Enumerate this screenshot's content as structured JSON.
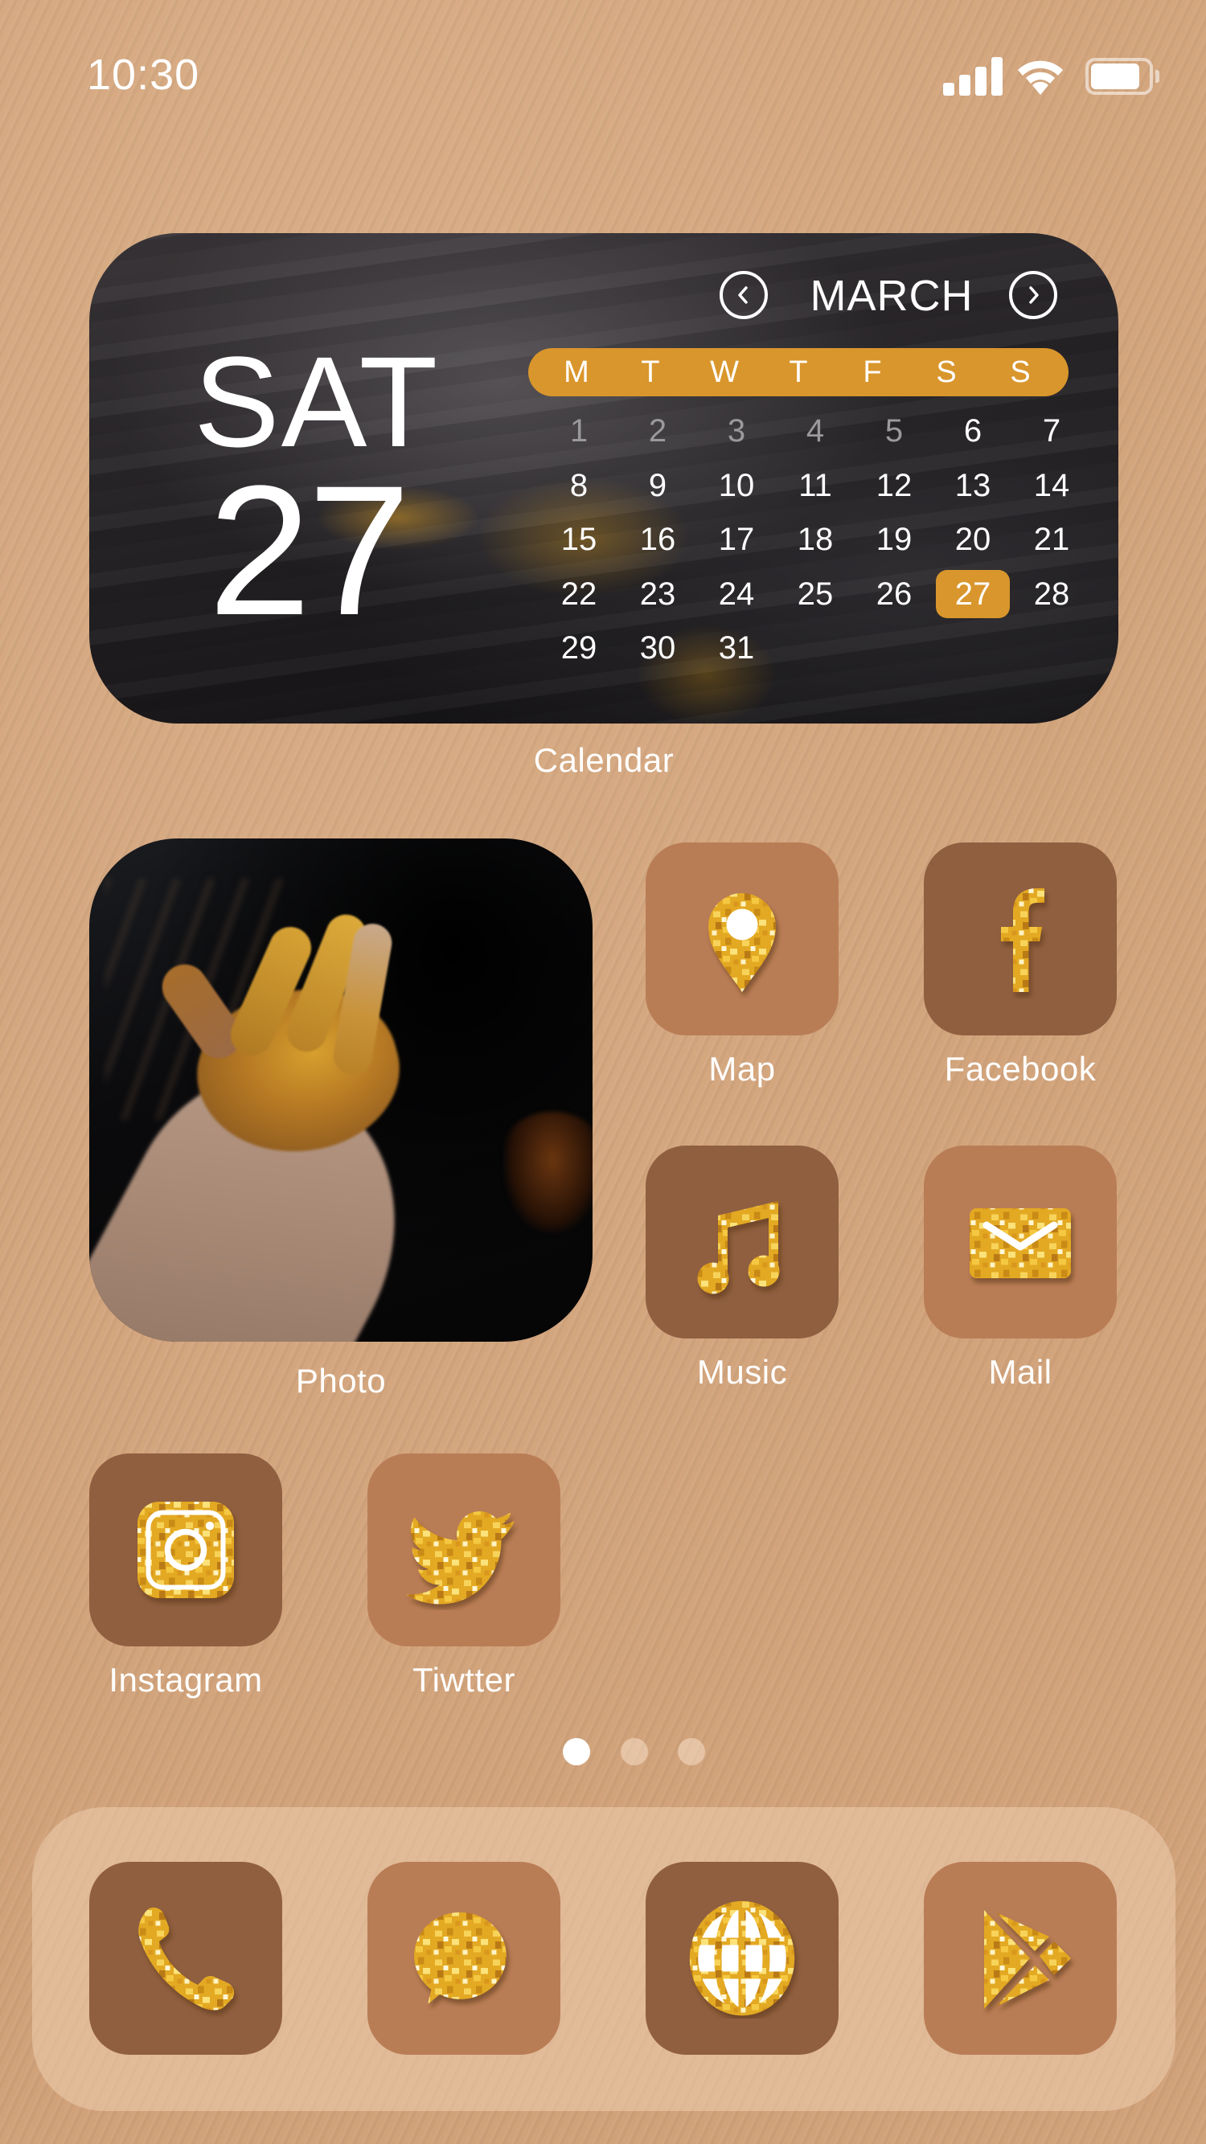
{
  "status_bar": {
    "time": "10:30",
    "signal_bars": 4,
    "wifi": "connected",
    "battery_level_percent": 85
  },
  "calendar_widget": {
    "day_of_week": "SAT",
    "day_number": "27",
    "month": "MARCH",
    "weekdays": [
      "M",
      "T",
      "W",
      "T",
      "F",
      "S",
      "S"
    ],
    "dates": [
      "1",
      "2",
      "3",
      "4",
      "5",
      "6",
      "7",
      "8",
      "9",
      "10",
      "11",
      "12",
      "13",
      "14",
      "15",
      "16",
      "17",
      "18",
      "19",
      "20",
      "21",
      "22",
      "23",
      "24",
      "25",
      "26",
      "27",
      "28",
      "29",
      "30",
      "31"
    ],
    "muted_dates": [
      "1",
      "2",
      "3",
      "4",
      "5"
    ],
    "today": "27",
    "label": "Calendar",
    "accent_color": "#d9962c",
    "prev_icon": "chevron-left-circle-icon",
    "next_icon": "chevron-right-circle-icon"
  },
  "photo_widget": {
    "label": "Photo",
    "description": "hand covered in gold paint"
  },
  "apps": [
    {
      "name": "Map",
      "icon": "map-pin-icon",
      "tile_color": "#b97d56"
    },
    {
      "name": "Facebook",
      "icon": "facebook-icon",
      "tile_color": "#905f40"
    },
    {
      "name": "Music",
      "icon": "music-note-icon",
      "tile_color": "#905f40"
    },
    {
      "name": "Mail",
      "icon": "mail-icon",
      "tile_color": "#b97d56"
    },
    {
      "name": "Instagram",
      "icon": "instagram-icon",
      "tile_color": "#905f40"
    },
    {
      "name": "Tiwtter",
      "icon": "twitter-bird-icon",
      "tile_color": "#b97d56"
    }
  ],
  "page_indicator": {
    "pages": 3,
    "current": 1
  },
  "dock": [
    {
      "name": "Phone",
      "icon": "phone-icon",
      "tile_color": "#905f40"
    },
    {
      "name": "Messages",
      "icon": "message-bubble-icon",
      "tile_color": "#b97d56"
    },
    {
      "name": "Browser",
      "icon": "globe-icon",
      "tile_color": "#905f40"
    },
    {
      "name": "Play Store",
      "icon": "play-store-icon",
      "tile_color": "#b97d56"
    }
  ],
  "colors": {
    "background": "#d3a57d",
    "gold": "#e8b52c",
    "dock_background": "#e0bb98"
  }
}
